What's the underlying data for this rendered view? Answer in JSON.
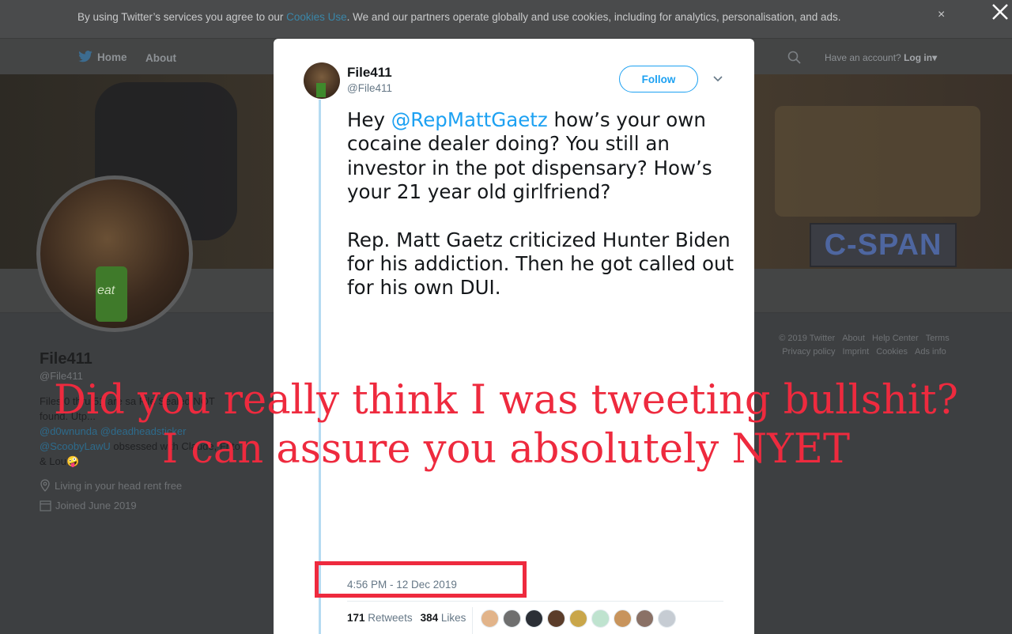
{
  "cookie_banner": {
    "text_before": "By using Twitter’s services you agree to our ",
    "link": "Cookies Use",
    "text_after": ". We and our partners operate globally and use cookies, including for analytics, personalisation, and ads.",
    "close_glyph": "×"
  },
  "nav": {
    "home": "Home",
    "about": "About",
    "account_prompt": "Have an account?",
    "login": "Log in",
    "login_caret": "▾"
  },
  "banner": {
    "network_logo_text": "C-SPAN"
  },
  "profile": {
    "name": "File411",
    "handle": "@File411",
    "bio_line1": "Files 0 thru 51 are sa File Sealed NOT",
    "bio_line2": "found. Utp...",
    "bio_mentions": "@d0wnunda @deadheadsticker",
    "bio_line3_mention": "@ScoobyLawU",
    "bio_line3_text": " obsessed with Claude, Frito",
    "bio_line4": "& Lou",
    "bio_emoji": "🤪",
    "location": "Living in your head rent free",
    "joined": "Joined June 2019"
  },
  "footer": {
    "links_row1": [
      "© 2019 Twitter",
      "About",
      "Help Center",
      "Terms"
    ],
    "links_row2": [
      "Privacy policy",
      "Imprint",
      "Cookies",
      "Ads info"
    ]
  },
  "tweet": {
    "author_name": "File411",
    "author_handle": "@File411",
    "follow_label": "Follow",
    "text_prefix": "Hey ",
    "mention": "@RepMattGaetz",
    "text_rest": " how’s your own cocaine dealer doing? You still an investor in the pot dispensary? How’s your 21 year old girlfriend?",
    "text_para2": "Rep. Matt Gaetz criticized Hunter Biden for his addiction. Then he got called out for his own DUI.",
    "timestamp": "4:56 PM - 12 Dec 2019",
    "retweets_count": "171",
    "retweets_label": "Retweets",
    "likes_count": "384",
    "likes_label": "Likes",
    "liker_colors": [
      "#e2b48a",
      "#6f6f6f",
      "#2b2f36",
      "#5b3d2a",
      "#c9a64a",
      "#bfe3cf",
      "#c8945c",
      "#8a7166",
      "#c6ccd3"
    ]
  },
  "meme_caption": {
    "line1": "Did you really think I was tweeting bullshit?",
    "line2": "I can assure you absolutely NYET"
  },
  "colors": {
    "twitter_blue": "#1da1f2",
    "caption_red": "#ee2a3e",
    "overlay": "#3d3f41"
  }
}
